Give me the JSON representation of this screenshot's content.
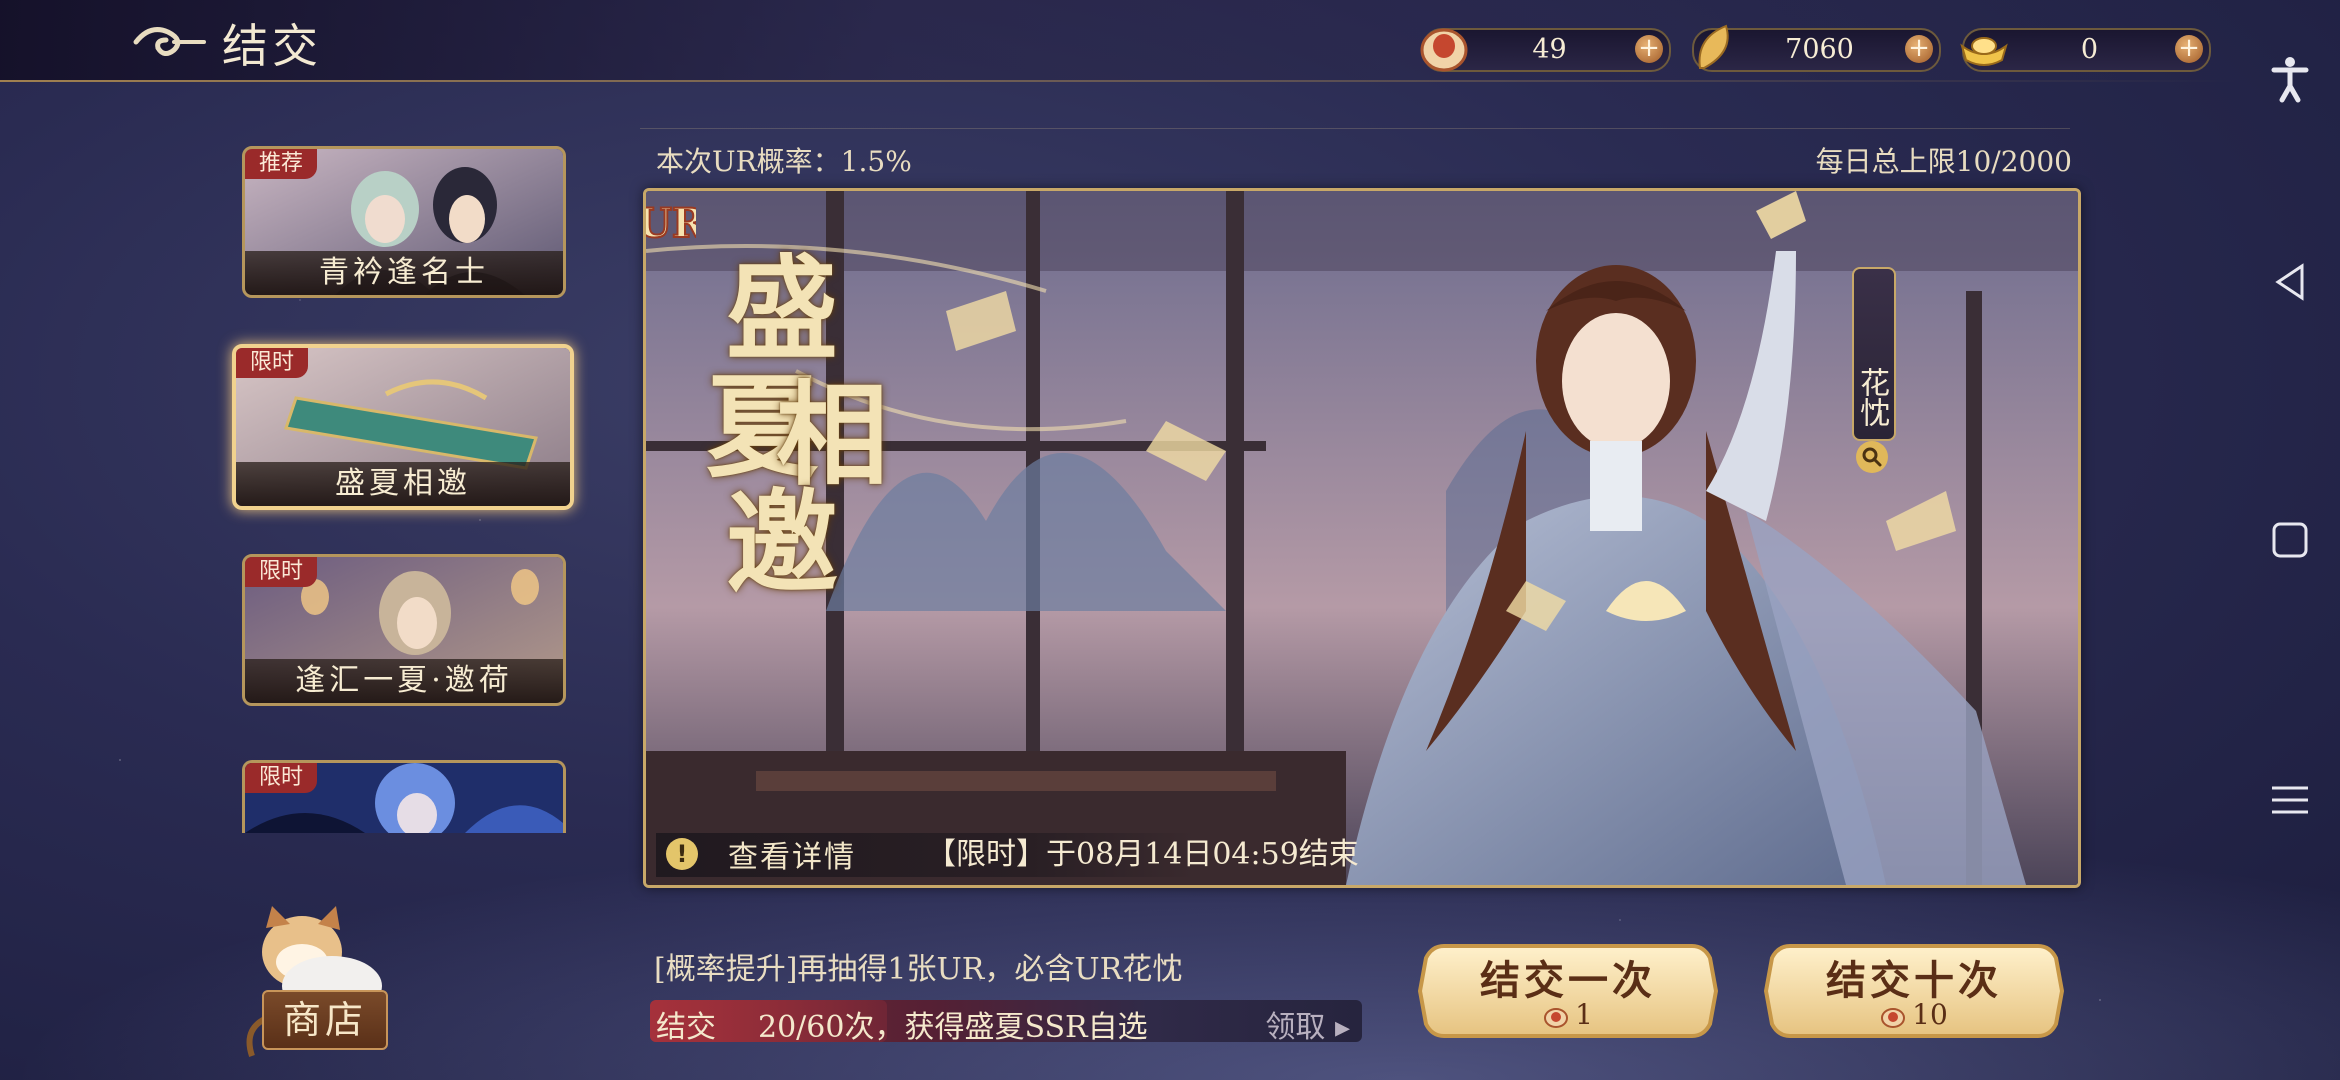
{
  "header": {
    "title": "结交"
  },
  "currencies": [
    {
      "icon": "peach-token-icon",
      "value": "49"
    },
    {
      "icon": "gold-leaf-icon",
      "value": "7060"
    },
    {
      "icon": "gold-ingot-icon",
      "value": "0"
    }
  ],
  "banners": [
    {
      "tag": "推荐",
      "label": "青衿逢名士",
      "active": false
    },
    {
      "tag": "限时",
      "label": "盛夏相邀",
      "active": true
    },
    {
      "tag": "限时",
      "label": "逢汇一夏·邀荷",
      "active": false
    },
    {
      "tag": "限时",
      "label": "",
      "active": false
    }
  ],
  "info": {
    "ur_rate": "本次UR概率：1.5%",
    "daily_limit": "每日总上限10/2000"
  },
  "event": {
    "title_chars": [
      "盛",
      "夏",
      "相",
      "邀"
    ],
    "ur_badge": "UR",
    "character_name": "花忱",
    "detail_button": "查看详情",
    "limit_text": "【限时】于08月14日04:59结束"
  },
  "bottom": {
    "rate_up": "[概率提升]再抽得1张UR，必含UR花忱",
    "progress_label": "结交",
    "progress_text": "20/60次，获得盛夏SSR自选",
    "progress_fraction": 0.333,
    "claim_label": "领取",
    "pull_once": {
      "label": "结交一次",
      "cost": "1"
    },
    "pull_ten": {
      "label": "结交十次",
      "cost": "10"
    },
    "shop_label": "商店"
  },
  "colors": {
    "accent_gold": "#c8a868",
    "tag_red": "#9a2a2a",
    "background": "#2a2b52"
  }
}
